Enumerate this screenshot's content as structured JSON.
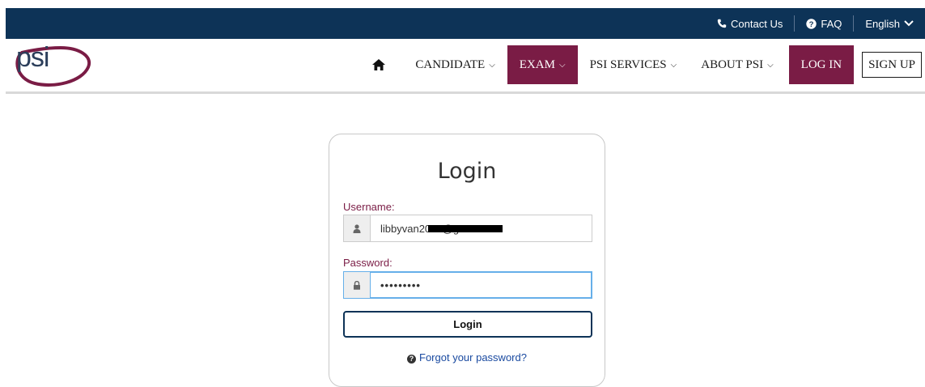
{
  "topbar": {
    "contact": "Contact Us",
    "faq": "FAQ",
    "language": "English"
  },
  "logo": {
    "text": "psi"
  },
  "nav": {
    "candidate": "CANDIDATE",
    "exam": "EXAM",
    "psi_services": "PSI SERVICES",
    "about": "ABOUT PSI",
    "login": "LOG IN",
    "signup": "SIGN UP",
    "chevron": "⌵"
  },
  "login_form": {
    "title": "Login",
    "username_label": "Username:",
    "username_value": "libbyvan2019@g",
    "password_label": "Password:",
    "password_value": "•••••••••",
    "submit_label": "Login",
    "forgot_label": "Forgot your password?"
  },
  "colors": {
    "topbar_bg": "#0d3357",
    "accent": "#7a1c45",
    "focus": "#66afe9"
  }
}
